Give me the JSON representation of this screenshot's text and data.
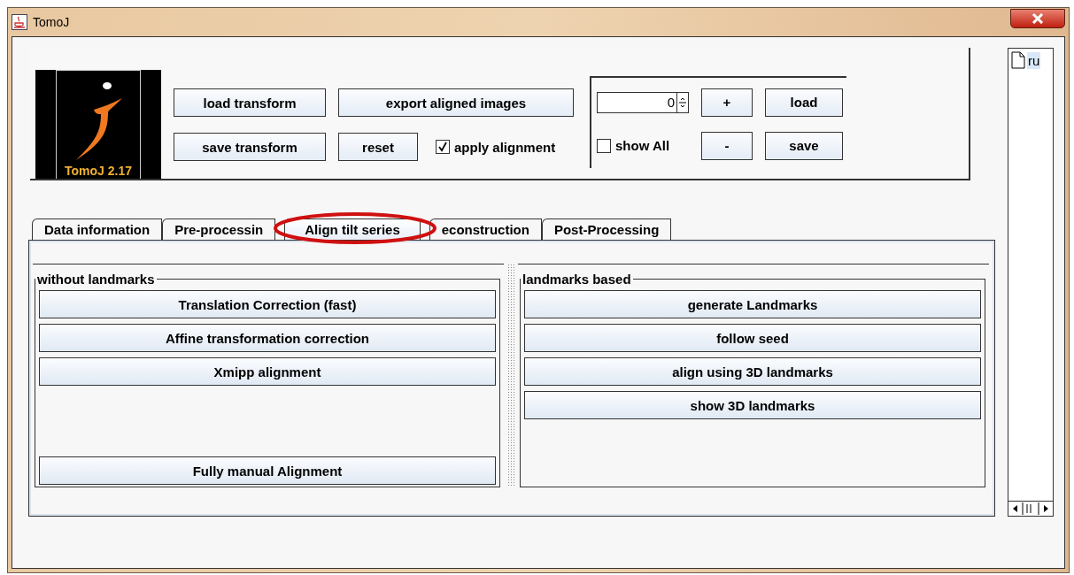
{
  "window": {
    "title": "TomoJ"
  },
  "logo": {
    "caption": "TomoJ 2.17"
  },
  "toolbar": {
    "buttons": [
      "load transform",
      "export aligned images",
      "save transform",
      "reset"
    ],
    "apply_alignment": {
      "label": "apply alignment",
      "checked": true
    }
  },
  "slice_panel": {
    "spinner_value": "0",
    "buttons": [
      "+",
      "load",
      "-",
      "save"
    ],
    "show_all": {
      "label": "show All",
      "checked": false
    }
  },
  "tabs": [
    {
      "label": "Data information",
      "selected": false
    },
    {
      "label": "Pre-processin",
      "selected": false
    },
    {
      "label": "Align tilt series",
      "selected": true
    },
    {
      "label": "econstruction",
      "selected": false
    },
    {
      "label": "Post-Processing",
      "selected": false
    }
  ],
  "without_landmarks": {
    "title": "without landmarks",
    "buttons": [
      "Translation Correction (fast)",
      "Affine transformation correction",
      "Xmipp alignment",
      "Fully manual Alignment"
    ]
  },
  "landmarks_based": {
    "title": "landmarks based",
    "buttons": [
      "generate Landmarks",
      "follow seed",
      "align using 3D landmarks",
      "show 3D landmarks"
    ]
  },
  "file_list": {
    "items": [
      {
        "name": "ru",
        "selected": true
      }
    ]
  }
}
